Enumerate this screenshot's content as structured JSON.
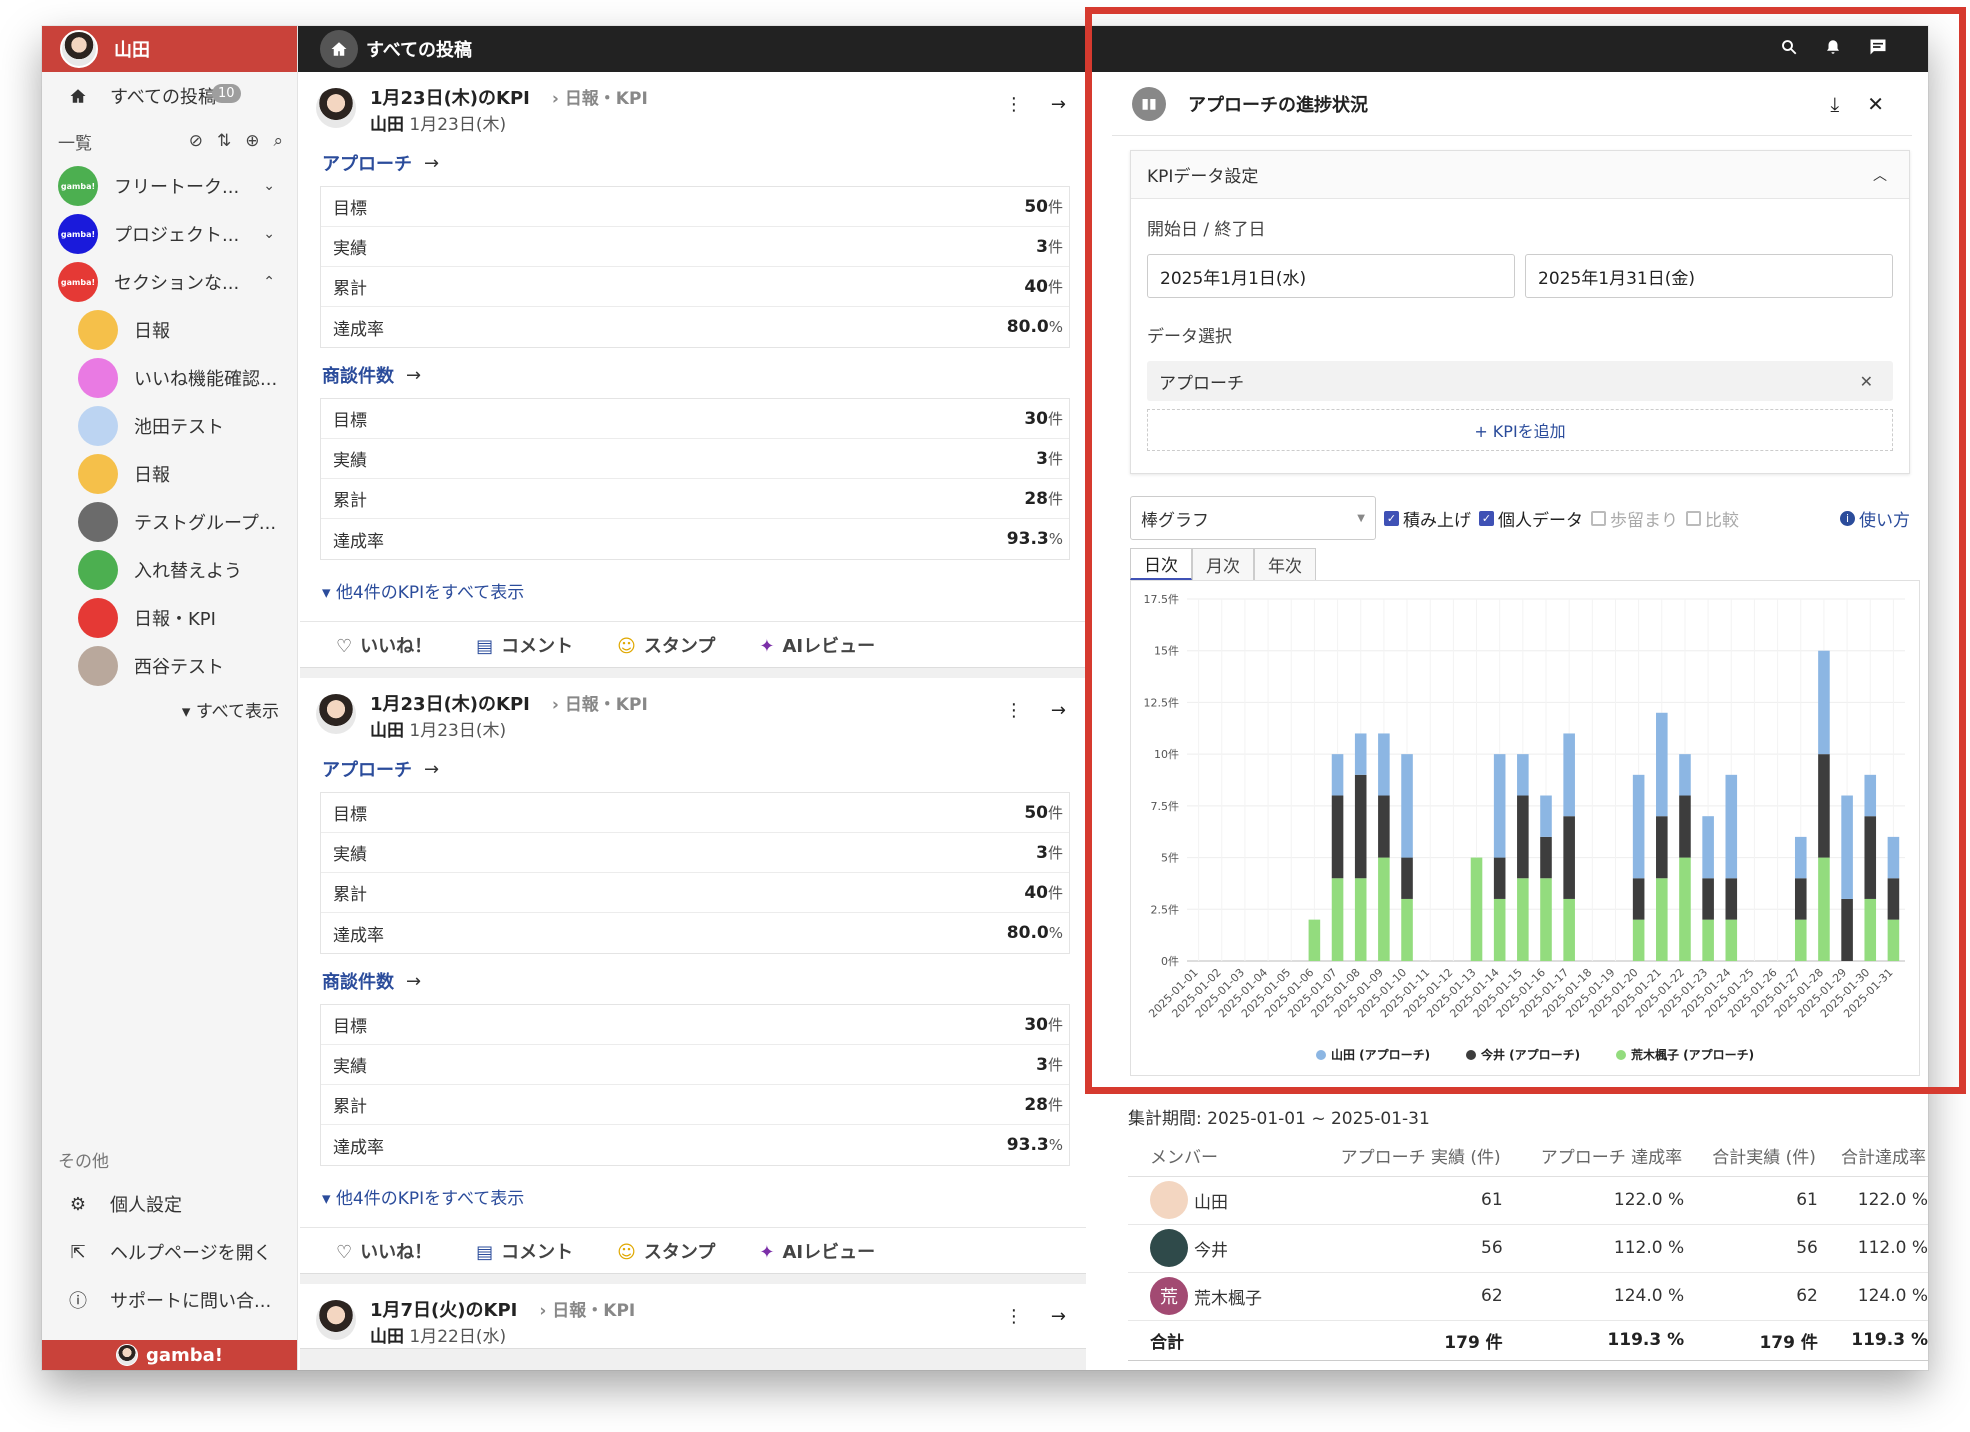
{
  "user": {
    "name": "山田"
  },
  "topbar": {
    "title": "すべての投稿"
  },
  "sidebar": {
    "all_posts": "すべての投稿",
    "all_posts_badge": "10",
    "list_label": "一覧",
    "groups": [
      {
        "label": "フリートーク...",
        "color": "#4caf50",
        "chev": "⌄"
      },
      {
        "label": "プロジェクト...",
        "color": "#1a1adb",
        "chev": "⌄"
      },
      {
        "label": "セクションな...",
        "color": "#e53935",
        "chev": "⌃"
      }
    ],
    "sub_items": [
      {
        "label": "日報",
        "color": "#f5c04a"
      },
      {
        "label": "いいね機能確認...",
        "color": "#e97ae3"
      },
      {
        "label": "池田テスト",
        "color": "#bcd4f2"
      },
      {
        "label": "日報",
        "color": "#f5c04a"
      },
      {
        "label": "テストグループ...",
        "color": "#6b6b6b"
      },
      {
        "label": "入れ替えよう",
        "color": "#4caf50"
      },
      {
        "label": "日報・KPI",
        "color": "#e53935"
      },
      {
        "label": "西谷テスト",
        "color": "#b9a89c"
      }
    ],
    "show_all": "すべて表示",
    "other_label": "その他",
    "other_items": [
      "個人設定",
      "ヘルプページを開く",
      "サポートに問い合..."
    ],
    "logo_text": "gamba!"
  },
  "posts": [
    {
      "title": "1月23日(木)のKPI",
      "category": "日報・KPI",
      "author": "山田",
      "date": "1月23日(木)",
      "kpis": [
        {
          "name": "アプローチ",
          "rows": [
            [
              "目標",
              "50",
              "件"
            ],
            [
              "実績",
              "3",
              "件"
            ],
            [
              "累計",
              "40",
              "件"
            ],
            [
              "達成率",
              "80.0",
              "%"
            ]
          ]
        },
        {
          "name": "商談件数",
          "rows": [
            [
              "目標",
              "30",
              "件"
            ],
            [
              "実績",
              "3",
              "件"
            ],
            [
              "累計",
              "28",
              "件"
            ],
            [
              "達成率",
              "93.3",
              "%"
            ]
          ]
        }
      ],
      "more": "他4件のKPIをすべて表示"
    },
    {
      "title": "1月23日(木)のKPI",
      "category": "日報・KPI",
      "author": "山田",
      "date": "1月23日(木)",
      "kpis": [
        {
          "name": "アプローチ",
          "rows": [
            [
              "目標",
              "50",
              "件"
            ],
            [
              "実績",
              "3",
              "件"
            ],
            [
              "累計",
              "40",
              "件"
            ],
            [
              "達成率",
              "80.0",
              "%"
            ]
          ]
        },
        {
          "name": "商談件数",
          "rows": [
            [
              "目標",
              "30",
              "件"
            ],
            [
              "実績",
              "3",
              "件"
            ],
            [
              "累計",
              "28",
              "件"
            ],
            [
              "達成率",
              "93.3",
              "%"
            ]
          ]
        }
      ],
      "more": "他4件のKPIをすべて表示"
    },
    {
      "title": "1月7日(火)のKPI",
      "category": "日報・KPI",
      "author": "山田",
      "date": "1月22日(水)"
    }
  ],
  "reactions": {
    "like": "いいね！",
    "comment": "コメント",
    "stamp": "スタンプ",
    "ai": "AIレビュー"
  },
  "panel": {
    "title": "アプローチの進捗状況",
    "settings_title": "KPIデータ設定",
    "date_label": "開始日 / 終了日",
    "start_date": "2025年1月1日(水)",
    "end_date": "2025年1月31日(金)",
    "data_label": "データ選択",
    "selected_kpi": "アプローチ",
    "add_kpi": "+ KPIを追加",
    "chart_type": "棒グラフ",
    "options": [
      {
        "label": "積み上げ",
        "checked": true
      },
      {
        "label": "個人データ",
        "checked": true
      },
      {
        "label": "歩留まり",
        "checked": false
      },
      {
        "label": "比較",
        "checked": false
      }
    ],
    "howto": "使い方",
    "tabs": [
      "日次",
      "月次",
      "年次"
    ],
    "active_tab": "日次"
  },
  "chart_data": {
    "type": "bar",
    "stacked": true,
    "x": [
      "2025-01-01",
      "2025-01-02",
      "2025-01-03",
      "2025-01-04",
      "2025-01-05",
      "2025-01-06",
      "2025-01-07",
      "2025-01-08",
      "2025-01-09",
      "2025-01-10",
      "2025-01-11",
      "2025-01-12",
      "2025-01-13",
      "2025-01-14",
      "2025-01-15",
      "2025-01-16",
      "2025-01-17",
      "2025-01-18",
      "2025-01-19",
      "2025-01-20",
      "2025-01-21",
      "2025-01-22",
      "2025-01-23",
      "2025-01-24",
      "2025-01-25",
      "2025-01-26",
      "2025-01-27",
      "2025-01-28",
      "2025-01-29",
      "2025-01-30",
      "2025-01-31"
    ],
    "series": [
      {
        "name": "荒木楓子 (アプローチ)",
        "color": "#93dc7e",
        "values": [
          0,
          0,
          0,
          0,
          0,
          2,
          4,
          4,
          5,
          3,
          0,
          0,
          5,
          3,
          4,
          4,
          3,
          0,
          0,
          2,
          4,
          5,
          2,
          2,
          0,
          0,
          2,
          5,
          0,
          3,
          2
        ]
      },
      {
        "name": "今井 (アプローチ)",
        "color": "#3d3d3d",
        "values": [
          0,
          0,
          0,
          0,
          0,
          0,
          4,
          5,
          3,
          2,
          0,
          0,
          0,
          2,
          4,
          2,
          4,
          0,
          0,
          2,
          3,
          3,
          2,
          2,
          0,
          0,
          2,
          5,
          3,
          4,
          2
        ]
      },
      {
        "name": "山田 (アプローチ)",
        "color": "#8cb6e3",
        "values": [
          0,
          0,
          0,
          0,
          0,
          0,
          2,
          2,
          3,
          5,
          0,
          0,
          0,
          5,
          2,
          2,
          4,
          0,
          0,
          5,
          5,
          2,
          3,
          5,
          0,
          0,
          2,
          5,
          5,
          2,
          2
        ]
      }
    ],
    "legend_order": [
      "山田 (アプローチ)",
      "今井 (アプローチ)",
      "荒木楓子 (アプローチ)"
    ],
    "y_ticks": [
      "0件",
      "2.5件",
      "5件",
      "7.5件",
      "10件",
      "12.5件",
      "15件",
      "17.5件"
    ],
    "ylim": [
      0,
      17.5
    ],
    "legend": "bottom"
  },
  "summary": {
    "period": "集計期間: 2025-01-01 ~ 2025-01-31",
    "headers": [
      "メンバー",
      "アプローチ 実績 (件)",
      "アプローチ 達成率",
      "合計実績 (件)",
      "合計達成率"
    ],
    "rows": [
      {
        "name": "山田",
        "avatar_color": "#f3d6c1",
        "cells": [
          "61",
          "122.0 %",
          "61",
          "122.0 %"
        ]
      },
      {
        "name": "今井",
        "avatar_color": "#2f4a4a",
        "cells": [
          "56",
          "112.0 %",
          "56",
          "112.0 %"
        ]
      },
      {
        "name": "荒木楓子",
        "avatar_color": "#a24a72",
        "avatar_text": "荒",
        "cells": [
          "62",
          "124.0 %",
          "62",
          "124.0 %"
        ]
      }
    ],
    "total": {
      "label": "合計",
      "cells": [
        "179 件",
        "119.3 %",
        "179 件",
        "119.3 %"
      ]
    }
  }
}
